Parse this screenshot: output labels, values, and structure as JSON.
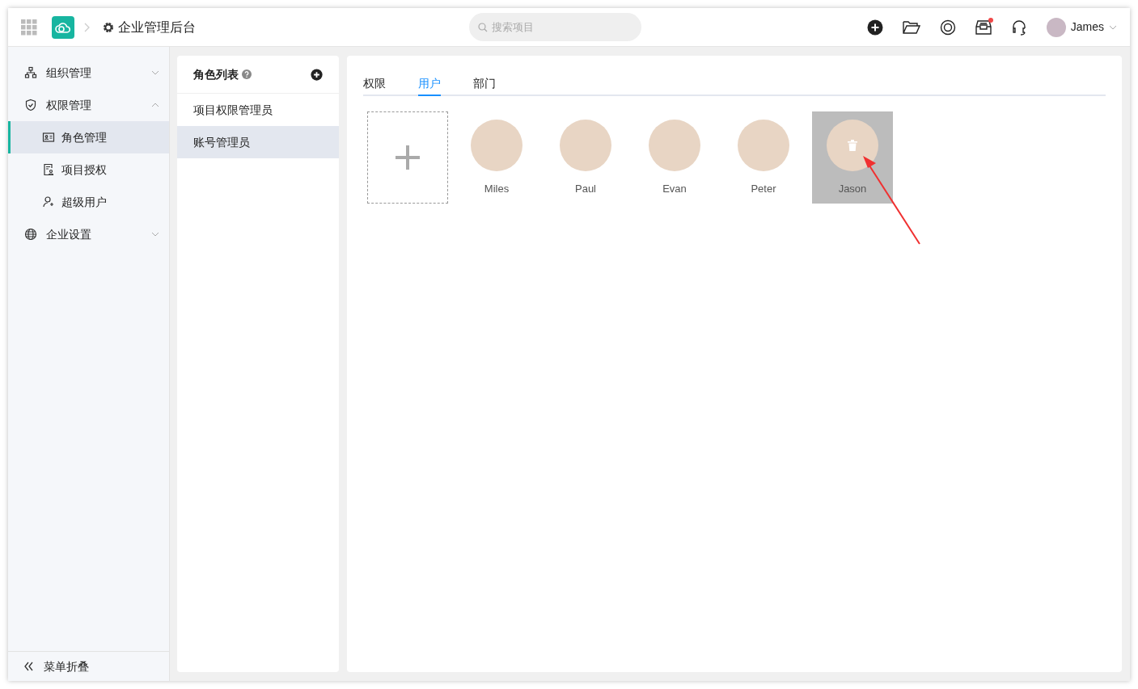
{
  "header": {
    "title": "企业管理后台",
    "search": {
      "placeholder": "搜索项目"
    },
    "user": {
      "name": "James"
    },
    "notification_dot": true
  },
  "sidebar": {
    "items": [
      {
        "label": "组织管理",
        "kind": "org",
        "expanded": false
      },
      {
        "label": "权限管理",
        "kind": "shield",
        "expanded": true,
        "children": [
          {
            "label": "角色管理",
            "kind": "card",
            "selected": true
          },
          {
            "label": "项目授权",
            "kind": "doc",
            "selected": false
          },
          {
            "label": "超级用户",
            "kind": "user",
            "selected": false
          }
        ]
      },
      {
        "label": "企业设置",
        "kind": "globe",
        "expanded": false
      }
    ],
    "collapse": {
      "label": "菜单折叠"
    }
  },
  "role_list": {
    "title": "角色列表",
    "items": [
      {
        "label": "项目权限管理员",
        "selected": false
      },
      {
        "label": "账号管理员",
        "selected": true
      }
    ]
  },
  "tabs": [
    {
      "label": "权限",
      "selected": false
    },
    {
      "label": "用户",
      "selected": true
    },
    {
      "label": "部门",
      "selected": false
    }
  ],
  "users": [
    {
      "name": "Miles",
      "selected": false
    },
    {
      "name": "Paul",
      "selected": false
    },
    {
      "name": "Evan",
      "selected": false
    },
    {
      "name": "Peter",
      "selected": false
    },
    {
      "name": "Jason",
      "selected": true
    }
  ]
}
